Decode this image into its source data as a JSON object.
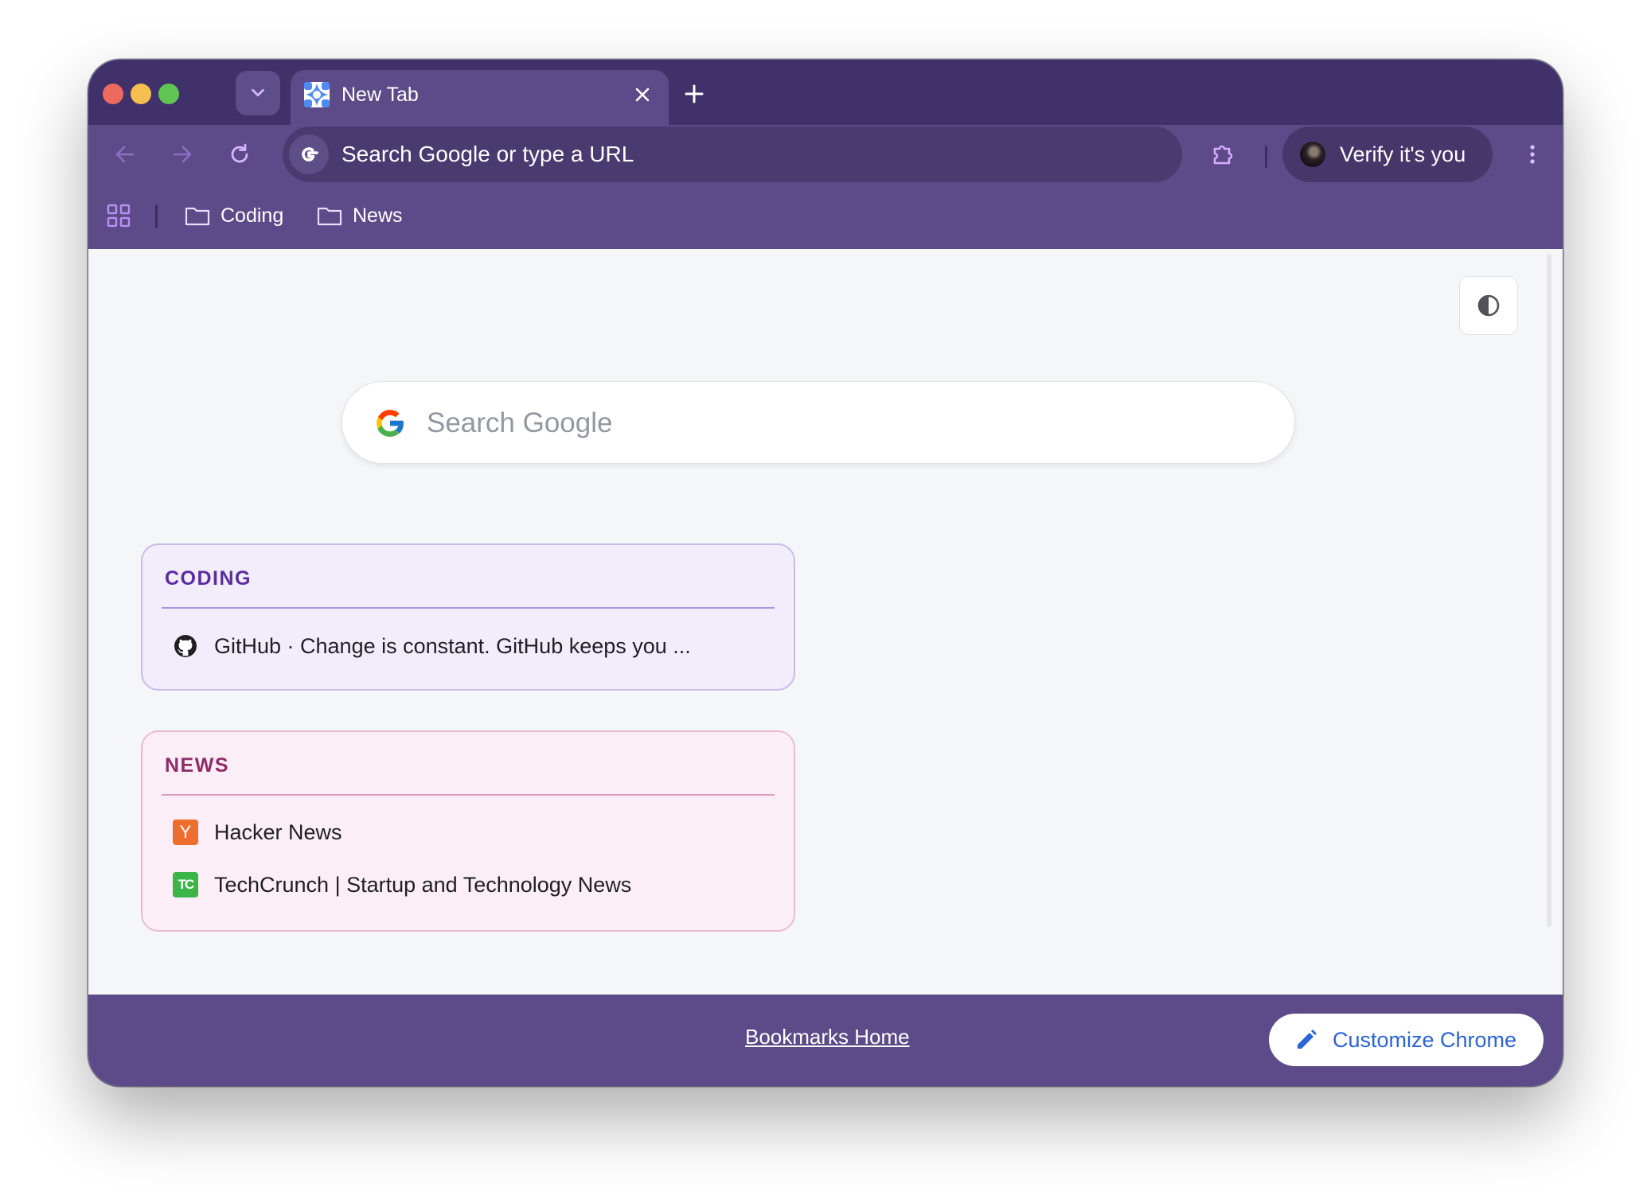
{
  "window": {
    "traffic_lights": [
      {
        "name": "close",
        "color": "#ed6a5e"
      },
      {
        "name": "minimize",
        "color": "#f4bf4f"
      },
      {
        "name": "zoom",
        "color": "#61c554"
      }
    ]
  },
  "tabs": [
    {
      "title": "New Tab",
      "favicon": "chrome-newtab-icon",
      "active": true
    }
  ],
  "toolbar": {
    "omnibox_text": "Search Google or type a URL",
    "profile_label": "Verify it's you",
    "icons": [
      "back-arrow-icon",
      "forward-arrow-icon",
      "reload-icon",
      "extensions-icon",
      "more-vert-icon"
    ]
  },
  "bookmarks_bar": {
    "items": [
      {
        "label": "Coding",
        "icon": "folder-icon"
      },
      {
        "label": "News",
        "icon": "folder-icon"
      }
    ]
  },
  "content": {
    "search_placeholder": "Search Google",
    "groups": [
      {
        "title": "CODING",
        "links": [
          {
            "title": "GitHub · Change is constant. GitHub keeps you ...",
            "icon": "github-icon"
          }
        ]
      },
      {
        "title": "NEWS",
        "links": [
          {
            "title": "Hacker News",
            "icon": "hacker-news-icon",
            "icon_text": "Y"
          },
          {
            "title": "TechCrunch | Startup and Technology News",
            "icon": "techcrunch-icon",
            "icon_text": "TC"
          }
        ]
      }
    ]
  },
  "footer": {
    "link_label": "Bookmarks Home",
    "customize_label": "Customize Chrome"
  },
  "colors": {
    "tabstrip": "#41316a",
    "toolbar": "#5c4b88",
    "accent_blue": "#2c63d6",
    "coding_title": "#5a2ca0",
    "news_title": "#8e2c6a"
  }
}
